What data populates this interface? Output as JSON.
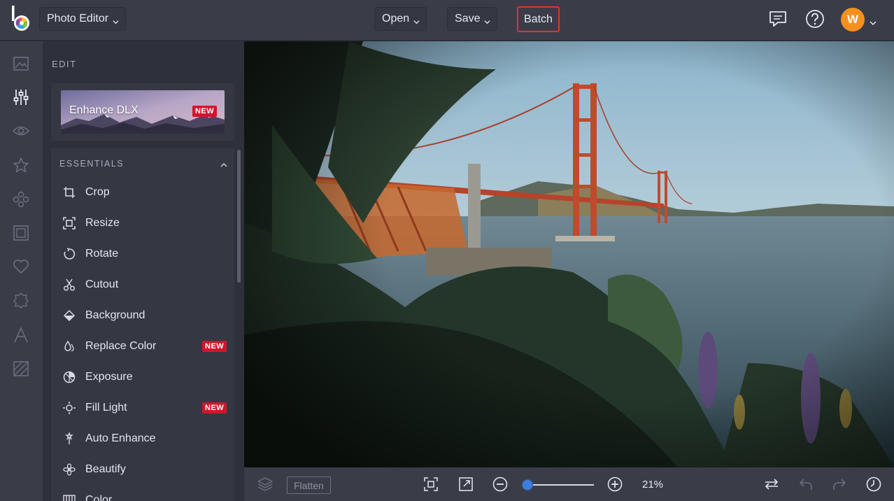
{
  "header": {
    "app_menu_label": "Photo Editor",
    "open_label": "Open",
    "save_label": "Save",
    "batch_label": "Batch",
    "icons": [
      "chat-icon",
      "help-icon"
    ],
    "avatar_initial": "W"
  },
  "sidebar_rail": {
    "icons": [
      "image-icon",
      "sliders-icon",
      "eye-icon",
      "star-icon",
      "shapes-icon",
      "frame-icon",
      "heart-icon",
      "badge-icon",
      "text-icon",
      "texture-icon"
    ],
    "active": "sliders-icon"
  },
  "panel": {
    "title": "EDIT",
    "enhance": {
      "label": "Enhance DLX",
      "badge": "NEW"
    },
    "section_title": "ESSENTIALS",
    "tools": [
      {
        "label": "Crop",
        "icon": "crop-icon",
        "badge": ""
      },
      {
        "label": "Resize",
        "icon": "resize-icon",
        "badge": ""
      },
      {
        "label": "Rotate",
        "icon": "rotate-icon",
        "badge": ""
      },
      {
        "label": "Cutout",
        "icon": "scissors-icon",
        "badge": ""
      },
      {
        "label": "Background",
        "icon": "eraser-icon",
        "badge": ""
      },
      {
        "label": "Replace Color",
        "icon": "drops-icon",
        "badge": "NEW"
      },
      {
        "label": "Exposure",
        "icon": "exposure-icon",
        "badge": ""
      },
      {
        "label": "Fill Light",
        "icon": "light-icon",
        "badge": "NEW"
      },
      {
        "label": "Auto Enhance",
        "icon": "wand-icon",
        "badge": ""
      },
      {
        "label": "Beautify",
        "icon": "flower-icon",
        "badge": ""
      },
      {
        "label": "Color",
        "icon": "color-icon",
        "badge": ""
      }
    ]
  },
  "bottom_bar": {
    "flatten_label": "Flatten",
    "zoom_percent": "21%",
    "zoom_value": 0.05
  },
  "colors": {
    "accent_blue": "#3d7dd8",
    "badge_red": "#d4142c",
    "avatar_orange": "#f5901e",
    "highlight_red": "#e0352b"
  }
}
